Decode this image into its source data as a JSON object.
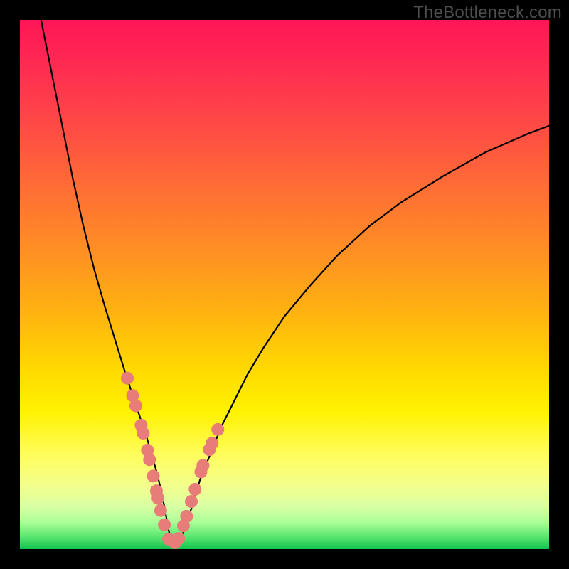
{
  "watermark": "TheBottleneck.com",
  "chart_data": {
    "type": "line",
    "title": "",
    "xlabel": "",
    "ylabel": "",
    "xlim": [
      0,
      100
    ],
    "ylim": [
      0,
      100
    ],
    "grid": false,
    "legend": false,
    "curve": {
      "x": [
        4,
        6,
        8,
        10,
        12,
        14,
        16,
        18,
        20,
        22,
        23,
        24,
        25,
        26,
        26.8,
        27.5,
        28,
        28.5,
        29,
        29.6,
        30.4,
        31.2,
        32.5,
        34,
        36,
        38,
        40,
        43,
        46,
        50,
        55,
        60,
        66,
        72,
        80,
        88,
        96,
        100
      ],
      "y": [
        100,
        90,
        80,
        70,
        61,
        53,
        46,
        39.5,
        33,
        27,
        24,
        21,
        17.5,
        14,
        10.5,
        7,
        4,
        2,
        1,
        1,
        2,
        4,
        8,
        13,
        18,
        23,
        27,
        33,
        38,
        44,
        50,
        55.5,
        61,
        65.5,
        70.5,
        75,
        78.5,
        80
      ]
    },
    "markers": {
      "x": [
        20.3,
        21.3,
        21.9,
        22.9,
        23.3,
        24.1,
        24.5,
        25.2,
        25.8,
        26.1,
        26.6,
        27.3,
        28.1,
        29.3,
        30.0,
        30.9,
        31.5,
        32.4,
        33.1,
        34.2,
        34.6,
        35.8,
        36.3,
        37.4
      ],
      "y": [
        32.3,
        29.0,
        27.1,
        23.4,
        21.9,
        18.7,
        16.9,
        13.8,
        11.0,
        9.6,
        7.3,
        4.6,
        1.9,
        1.2,
        2.0,
        4.4,
        6.2,
        9.0,
        11.3,
        14.6,
        15.8,
        18.8,
        20.0,
        22.6
      ],
      "color": "#e77c78",
      "size": 9
    }
  }
}
